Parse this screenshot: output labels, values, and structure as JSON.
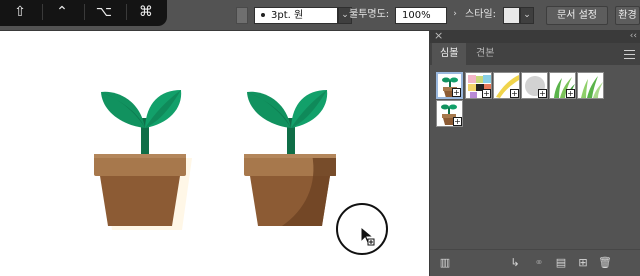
{
  "control_bar": {
    "stroke_weight_value": "3pt. 원",
    "opacity_label": "불투명도:",
    "opacity_value": "100%",
    "style_label": "스타일:",
    "doc_settings_button": "문서 설정",
    "preferences_button": "환경"
  },
  "modifier_keys": {
    "shift": "⇧",
    "control": "⌃",
    "option": "⌥",
    "command": "⌘"
  },
  "panel": {
    "tabs": [
      {
        "label": "심볼",
        "active": true
      },
      {
        "label": "견본",
        "active": false
      }
    ],
    "symbols": [
      {
        "name": "plant-pot",
        "selected": true
      },
      {
        "name": "confetti",
        "selected": false
      },
      {
        "name": "yellow-streak",
        "selected": false
      },
      {
        "name": "gray-circle",
        "selected": false
      },
      {
        "name": "grass",
        "selected": false
      },
      {
        "name": "grass-2",
        "selected": false
      },
      {
        "name": "plant-pot-small",
        "selected": false
      }
    ],
    "footer_icons": [
      "library-icon",
      "place-symbol-icon",
      "break-link-icon",
      "symbol-options-icon",
      "new-symbol-icon",
      "delete-icon"
    ]
  },
  "colors": {
    "leaf_dark": "#0f8a5a",
    "leaf_light": "#19a86b",
    "stem": "#137a52",
    "pot_rim": "#a7784c",
    "pot_body": "#8c5b34",
    "pot_shadow": "#6f4424",
    "panel_bg": "#535353",
    "toolbar_bg": "#535353"
  }
}
